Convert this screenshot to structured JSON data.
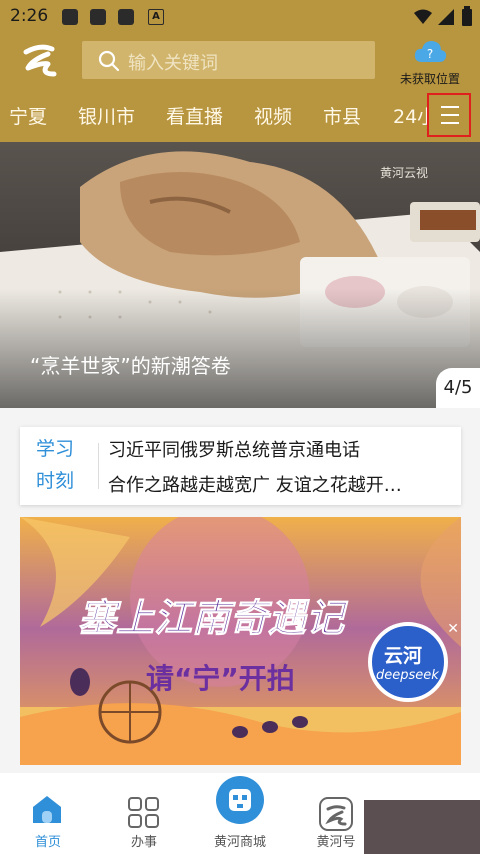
{
  "status_bar": {
    "time": "2:26",
    "notif_letter": "A"
  },
  "header": {
    "search_placeholder": "输入关键词",
    "location_text": "未获取位置",
    "location_icon": "cloud-question-icon"
  },
  "channels": [
    "宁夏",
    "银川市",
    "看直播",
    "视频",
    "市县",
    "24小"
  ],
  "hero": {
    "caption": "“烹羊世家”的新潮答卷",
    "page": "4/5",
    "watermark": "黄河云视"
  },
  "study": {
    "tag_line1": "学习",
    "tag_line2": "时刻",
    "headline1": "习近平同俄罗斯总统普京通电话",
    "headline2": "合作之路越走越宽广 友谊之花越开…"
  },
  "banner": {
    "title": "塞上江南奇遇记",
    "subtitle": "请“宁”开拍",
    "badge_main": "云河",
    "badge_sub": "deepseek"
  },
  "bottom_nav": [
    {
      "label": "首页",
      "icon": "home-icon",
      "active": true
    },
    {
      "label": "办事",
      "icon": "grid-icon",
      "active": false
    },
    {
      "label": "黄河商城",
      "icon": "shop-icon",
      "active": false
    },
    {
      "label": "黄河号",
      "icon": "yellow-river-logo-icon",
      "active": false
    }
  ],
  "colors": {
    "header_bg": "#b8953f",
    "accent_blue": "#2f8fd8",
    "highlight_red": "#e0201c"
  }
}
